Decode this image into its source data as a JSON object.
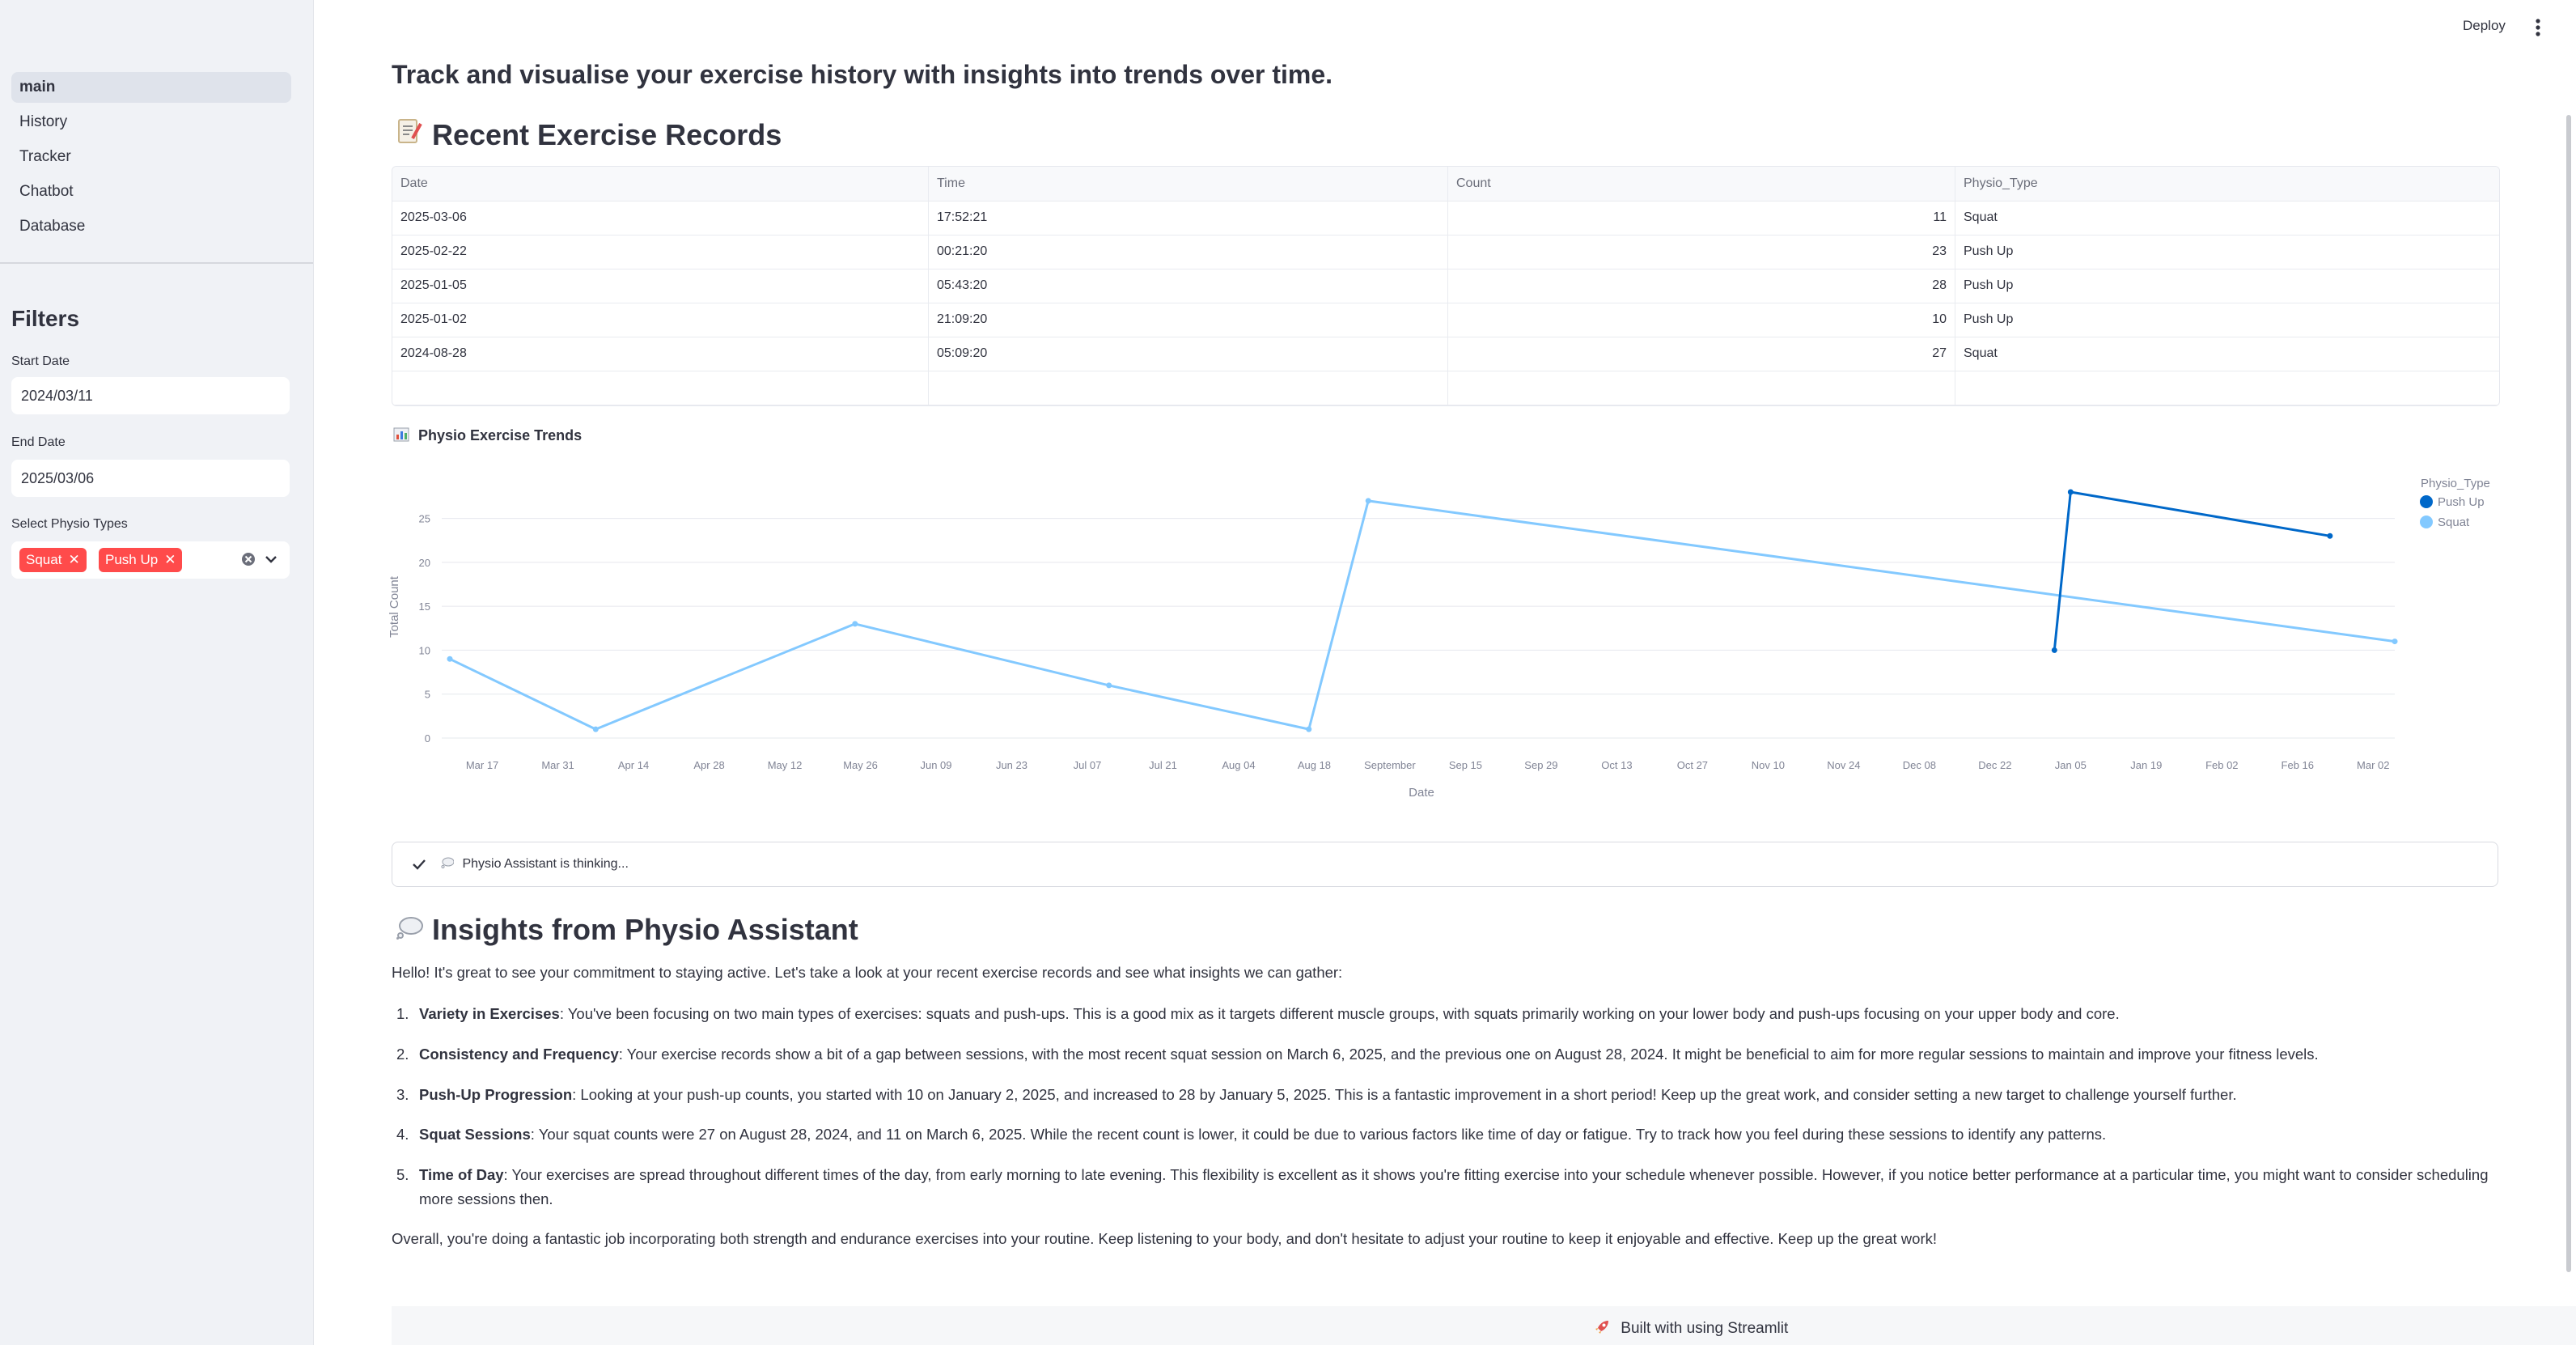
{
  "header": {
    "deploy_label": "Deploy",
    "menu_icon": "vertical-ellipsis-icon"
  },
  "sidebar": {
    "nav": [
      {
        "label": "main",
        "active": true
      },
      {
        "label": "History",
        "active": false
      },
      {
        "label": "Tracker",
        "active": false
      },
      {
        "label": "Chatbot",
        "active": false
      },
      {
        "label": "Database",
        "active": false
      }
    ],
    "filters_title": "Filters",
    "start_date_label": "Start Date",
    "start_date_value": "2024/03/11",
    "end_date_label": "End Date",
    "end_date_value": "2025/03/06",
    "physio_types_label": "Select Physio Types",
    "physio_types_selected": [
      "Squat",
      "Push Up"
    ],
    "tag_color": "#ff4b4b"
  },
  "main": {
    "title": "Track and visualise your exercise history with insights into trends over time.",
    "records_heading": "Recent Exercise Records",
    "records_icon": "memo-icon",
    "table": {
      "columns": [
        "Date",
        "Time",
        "Count",
        "Physio_Type"
      ],
      "rows": [
        [
          "2025-03-06",
          "17:52:21",
          "11",
          "Squat"
        ],
        [
          "2025-02-22",
          "00:21:20",
          "23",
          "Push Up"
        ],
        [
          "2025-01-05",
          "05:43:20",
          "28",
          "Push Up"
        ],
        [
          "2025-01-02",
          "21:09:20",
          "10",
          "Push Up"
        ],
        [
          "2024-08-28",
          "05:09:20",
          "27",
          "Squat"
        ]
      ]
    },
    "chart_heading": "Physio Exercise Trends",
    "chart_icon": "bar-chart-icon",
    "status_text": "Physio Assistant is thinking...",
    "insights_heading": "Insights from Physio Assistant",
    "insights_icon": "thought-bubble-icon",
    "insights_intro": "Hello! It's great to see your commitment to staying active. Let's take a look at your recent exercise records and see what insights we can gather:",
    "insights": [
      {
        "num": "1.",
        "title": "Variety in Exercises",
        "text": ": You've been focusing on two main types of exercises: squats and push-ups. This is a good mix as it targets different muscle groups, with squats primarily working on your lower body and push-ups focusing on your upper body and core."
      },
      {
        "num": "2.",
        "title": "Consistency and Frequency",
        "text": ": Your exercise records show a bit of a gap between sessions, with the most recent squat session on March 6, 2025, and the previous one on August 28, 2024. It might be beneficial to aim for more regular sessions to maintain and improve your fitness levels."
      },
      {
        "num": "3.",
        "title": "Push-Up Progression",
        "text": ": Looking at your push-up counts, you started with 10 on January 2, 2025, and increased to 28 by January 5, 2025. This is a fantastic improvement in a short period! Keep up the great work, and consider setting a new target to challenge yourself further."
      },
      {
        "num": "4.",
        "title": "Squat Sessions",
        "text": ": Your squat counts were 27 on August 28, 2024, and 11 on March 6, 2025. While the recent count is lower, it could be due to various factors like time of day or fatigue. Try to track how you feel during these sessions to identify any patterns."
      },
      {
        "num": "5.",
        "title": "Time of Day",
        "text": ": Your exercises are spread throughout different times of the day, from early morning to late evening. This flexibility is excellent as it shows you're fitting exercise into your schedule whenever possible. However, if you notice better performance at a particular time, you might want to consider scheduling more sessions then."
      }
    ],
    "insights_outro": "Overall, you're doing a fantastic job incorporating both strength and endurance exercises into your routine. Keep listening to your body, and don't hesitate to adjust your routine to keep it enjoyable and effective. Keep up the great work!"
  },
  "footer": {
    "text": "Built with using Streamlit",
    "icon": "rocket-icon"
  },
  "chart_data": {
    "type": "line",
    "xlabel": "Date",
    "ylabel": "Total Count",
    "ylim": [
      0,
      28
    ],
    "yticks": [
      0,
      5,
      10,
      15,
      20,
      25
    ],
    "xticks": [
      "Mar 17",
      "Mar 31",
      "Apr 14",
      "Apr 28",
      "May 12",
      "May 26",
      "Jun 09",
      "Jun 23",
      "Jul 07",
      "Jul 21",
      "Aug 04",
      "Aug 18",
      "September",
      "Sep 15",
      "Sep 29",
      "Oct 13",
      "Oct 27",
      "Nov 10",
      "Nov 24",
      "Dec 08",
      "Dec 22",
      "Jan 05",
      "Jan 19",
      "Feb 02",
      "Feb 16",
      "Mar 02"
    ],
    "legend_title": "Physio_Type",
    "legend_position": "right",
    "grid": true,
    "series": [
      {
        "name": "Push Up",
        "color": "#0068c9",
        "x": [
          "2025-01-02",
          "2025-01-05",
          "2025-02-22"
        ],
        "y": [
          10,
          28,
          23
        ]
      },
      {
        "name": "Squat",
        "color": "#83c9ff",
        "x": [
          "2024-03-11",
          "2024-04-07",
          "2024-05-25",
          "2024-07-11",
          "2024-08-17",
          "2024-08-28",
          "2025-03-06"
        ],
        "y": [
          9,
          1,
          13,
          6,
          1,
          27,
          11
        ]
      }
    ]
  }
}
